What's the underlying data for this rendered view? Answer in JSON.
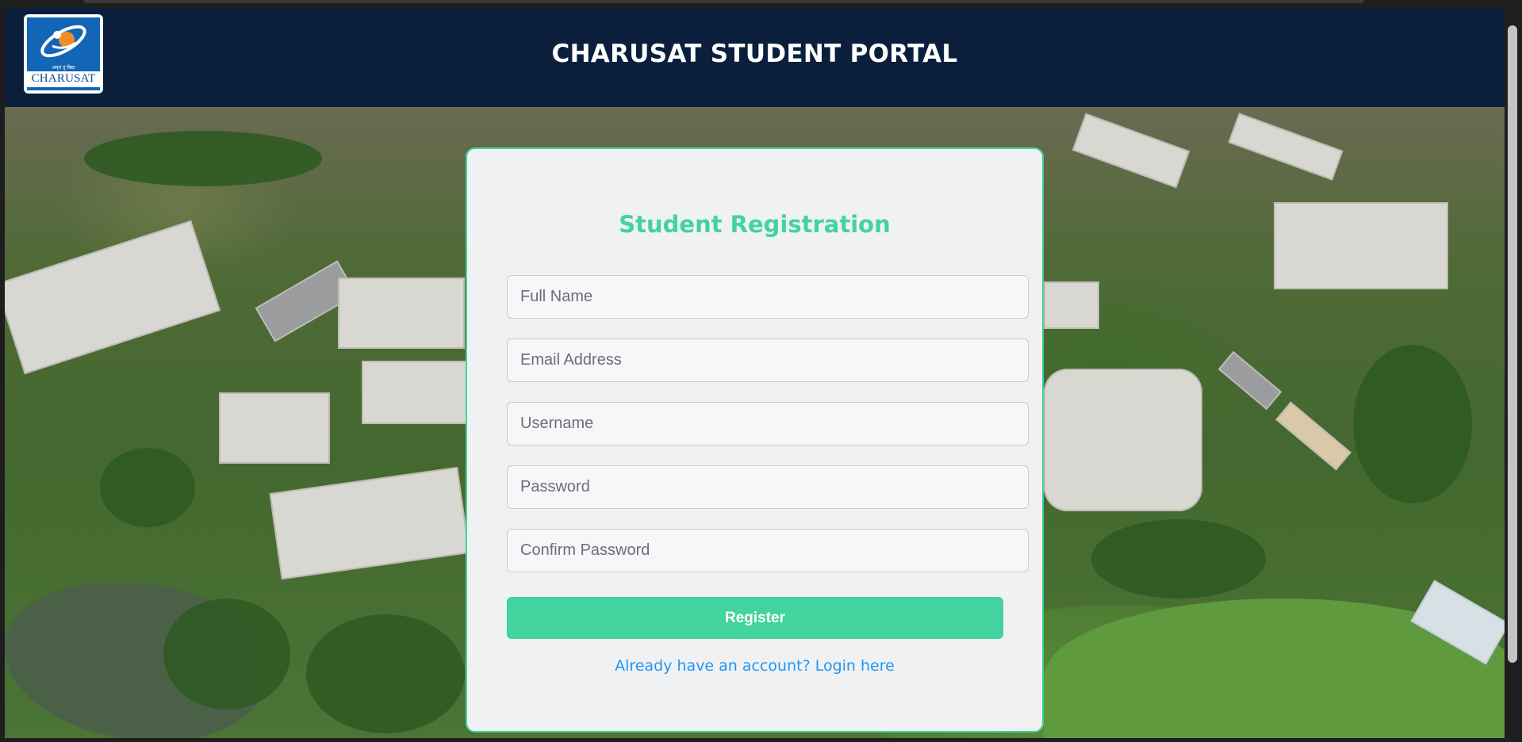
{
  "header": {
    "title": "CHARUSAT STUDENT PORTAL",
    "logo": {
      "text": "CHARUSAT",
      "motto": "अमृतं तु विद्या",
      "icon": "charusat-logo-icon"
    }
  },
  "form": {
    "title": "Student Registration",
    "fields": {
      "full_name": {
        "placeholder": "Full Name",
        "value": ""
      },
      "email": {
        "placeholder": "Email Address",
        "value": ""
      },
      "username": {
        "placeholder": "Username",
        "value": ""
      },
      "password": {
        "placeholder": "Password",
        "value": ""
      },
      "confirm_password": {
        "placeholder": "Confirm Password",
        "value": ""
      }
    },
    "register_label": "Register",
    "login_link_text": "Already have an account? Login here"
  },
  "colors": {
    "header_bg": "#0b1f3d",
    "accent": "#43d39e",
    "link": "#2196f3",
    "card_bg": "#f0f1f3"
  }
}
